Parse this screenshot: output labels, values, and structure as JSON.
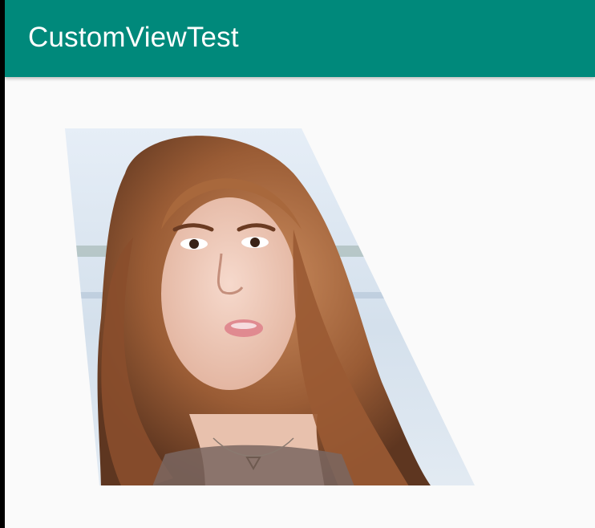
{
  "app_bar": {
    "title": "CustomViewTest",
    "color": "#00897b"
  },
  "content": {
    "background": "#fafafa",
    "image": {
      "subject": "portrait-photo"
    }
  }
}
